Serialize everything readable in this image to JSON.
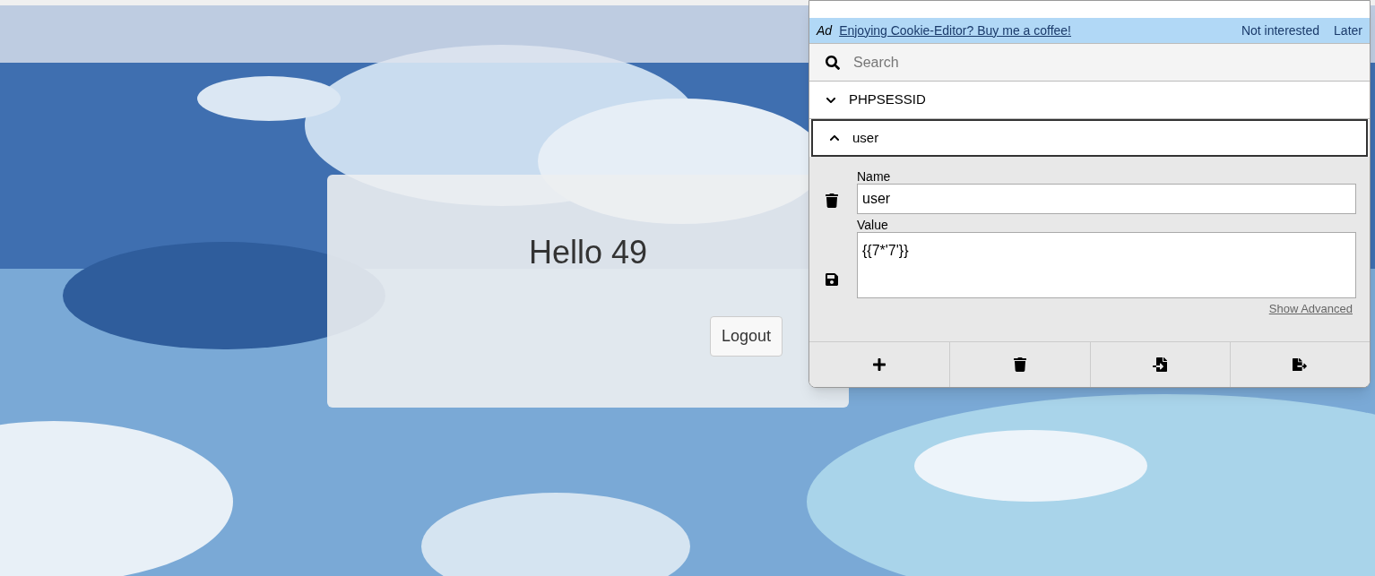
{
  "page": {
    "greeting": "Hello 49",
    "logout_button": "Logout"
  },
  "cookie_editor": {
    "ad": {
      "tag": "Ad",
      "link": "Enjoying Cookie-Editor? Buy me a coffee!",
      "actions": [
        "Not interested",
        "Later"
      ]
    },
    "search": {
      "placeholder": "Search"
    },
    "cookies": [
      {
        "name": "PHPSESSID",
        "expanded": false
      },
      {
        "name": "user",
        "expanded": true,
        "fields": {
          "name_label": "Name",
          "name_value": "user",
          "value_label": "Value",
          "value_value": "{{7*'7'}}",
          "advanced_link": "Show Advanced"
        }
      }
    ],
    "toolbar": [
      {
        "kind": "add"
      },
      {
        "kind": "delete"
      },
      {
        "kind": "import"
      },
      {
        "kind": "export"
      }
    ]
  }
}
